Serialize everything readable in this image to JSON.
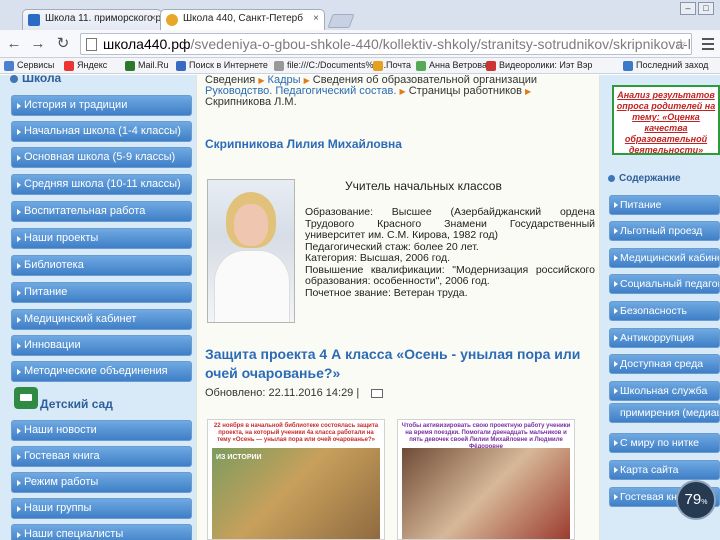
{
  "browser": {
    "tabs": [
      {
        "title": "Школа 11. приморского ра",
        "close": "×"
      },
      {
        "title": "Школа 440, Санкт-Петерб",
        "close": "×"
      }
    ],
    "url_host": "школа440.рф",
    "url_path": "/svedeniya-o-gbou-shkole-440/kollektiv-shkoly/stranitsy-sotrudnikov/skripnikova-l-m-2",
    "bookmarks": [
      "Сервисы",
      "Яндекс",
      "Mail.Ru",
      "Поиск в Интернете",
      "file:///C:/Documents%2...",
      "Почта",
      "Анна Ветрова",
      "Видеоролики: Иэт Вэр",
      "Последний заход"
    ]
  },
  "left_sidebar": {
    "school_heading": "Школа",
    "school_items": [
      "История и традиции",
      "Начальная школа (1-4 классы)",
      "Основная школа (5-9 классы)",
      "Средняя школа (10-11 классы)",
      "Воспитательная работа",
      "Наши проекты",
      "Библиотека",
      "Питание",
      "Медицинский кабинет",
      "Инновации",
      "Методические объединения"
    ],
    "kindergarten_heading": "Детский сад",
    "kindergarten_items": [
      "Наши новости",
      "Гостевая книга",
      "Режим работы",
      "Наши группы",
      "Наши специалисты"
    ]
  },
  "content": {
    "crumb1_prefix": "Сведения",
    "crumb1_link": "Кадры",
    "crumb1_text": "Сведения об образовательной организации",
    "crumb2_link": "Руководство. Педагогический состав.",
    "crumb2_text": "Страницы работников",
    "crumb3": "Скрипникова Л.М.",
    "person_name": "Скрипникова Лилия Михайловна",
    "job_title": "Учитель начальных классов",
    "bio": "Образование: Высшее (Азербайджанский ордена Трудового Красного Знамени Государственный университет им. С.М. Кирова, 1982 год)\nПедагогический стаж: более 20 лет.\nКатегория: Высшая, 2006 год.\nПовышение квалификации: \"Модернизация российского образования: особенности\", 2006 год.\nПочетное звание: Ветеран труда.",
    "article_title": "Защита проекта 4 А класса «Осень - унылая пора или очей очарованье?»",
    "updated": "Обновлено: 22.11.2016 14:29",
    "updated_sep": "|",
    "thumb1_caption": "22 ноября в начальной библиотеке состоялась защита проекта, на который ученики 4а класса работали на тему «Осень — унылая пора или очей очарованье?»",
    "thumb1_tag": "ИЗ ИСТОРИИ",
    "thumb2_caption": "Чтобы активизировать свою проектную работу ученики на время поездки. Помогали двенадцать мальчиков и пять девочек своей Лилии Михайловне и Людмиле Фёдоровне"
  },
  "right_sidebar": {
    "banner": "Анализ результатов опроса родителей на тему: «Оценка качества образовательной деятельности»",
    "contents_heading": "Содержание",
    "items": [
      {
        "label": "Питание",
        "cont": false
      },
      {
        "label": "Льготный проезд",
        "cont": false
      },
      {
        "label": "Медицинский кабинет",
        "cont": false
      },
      {
        "label": "Социальный педагог",
        "cont": false
      },
      {
        "label": "Безопасность",
        "cont": false
      },
      {
        "label": "Антикоррупция",
        "cont": false
      },
      {
        "label": "Доступная среда",
        "cont": false
      },
      {
        "label": "Школьная служба",
        "cont": false
      },
      {
        "label": "примирения (медиация)",
        "cont": true
      },
      {
        "label": "С миру по нитке",
        "cont": false
      },
      {
        "label": "Карта сайта",
        "cont": false
      },
      {
        "label": "Гостевая книга",
        "cont": false
      }
    ]
  },
  "counter": {
    "value": "79",
    "suffix": "%"
  }
}
